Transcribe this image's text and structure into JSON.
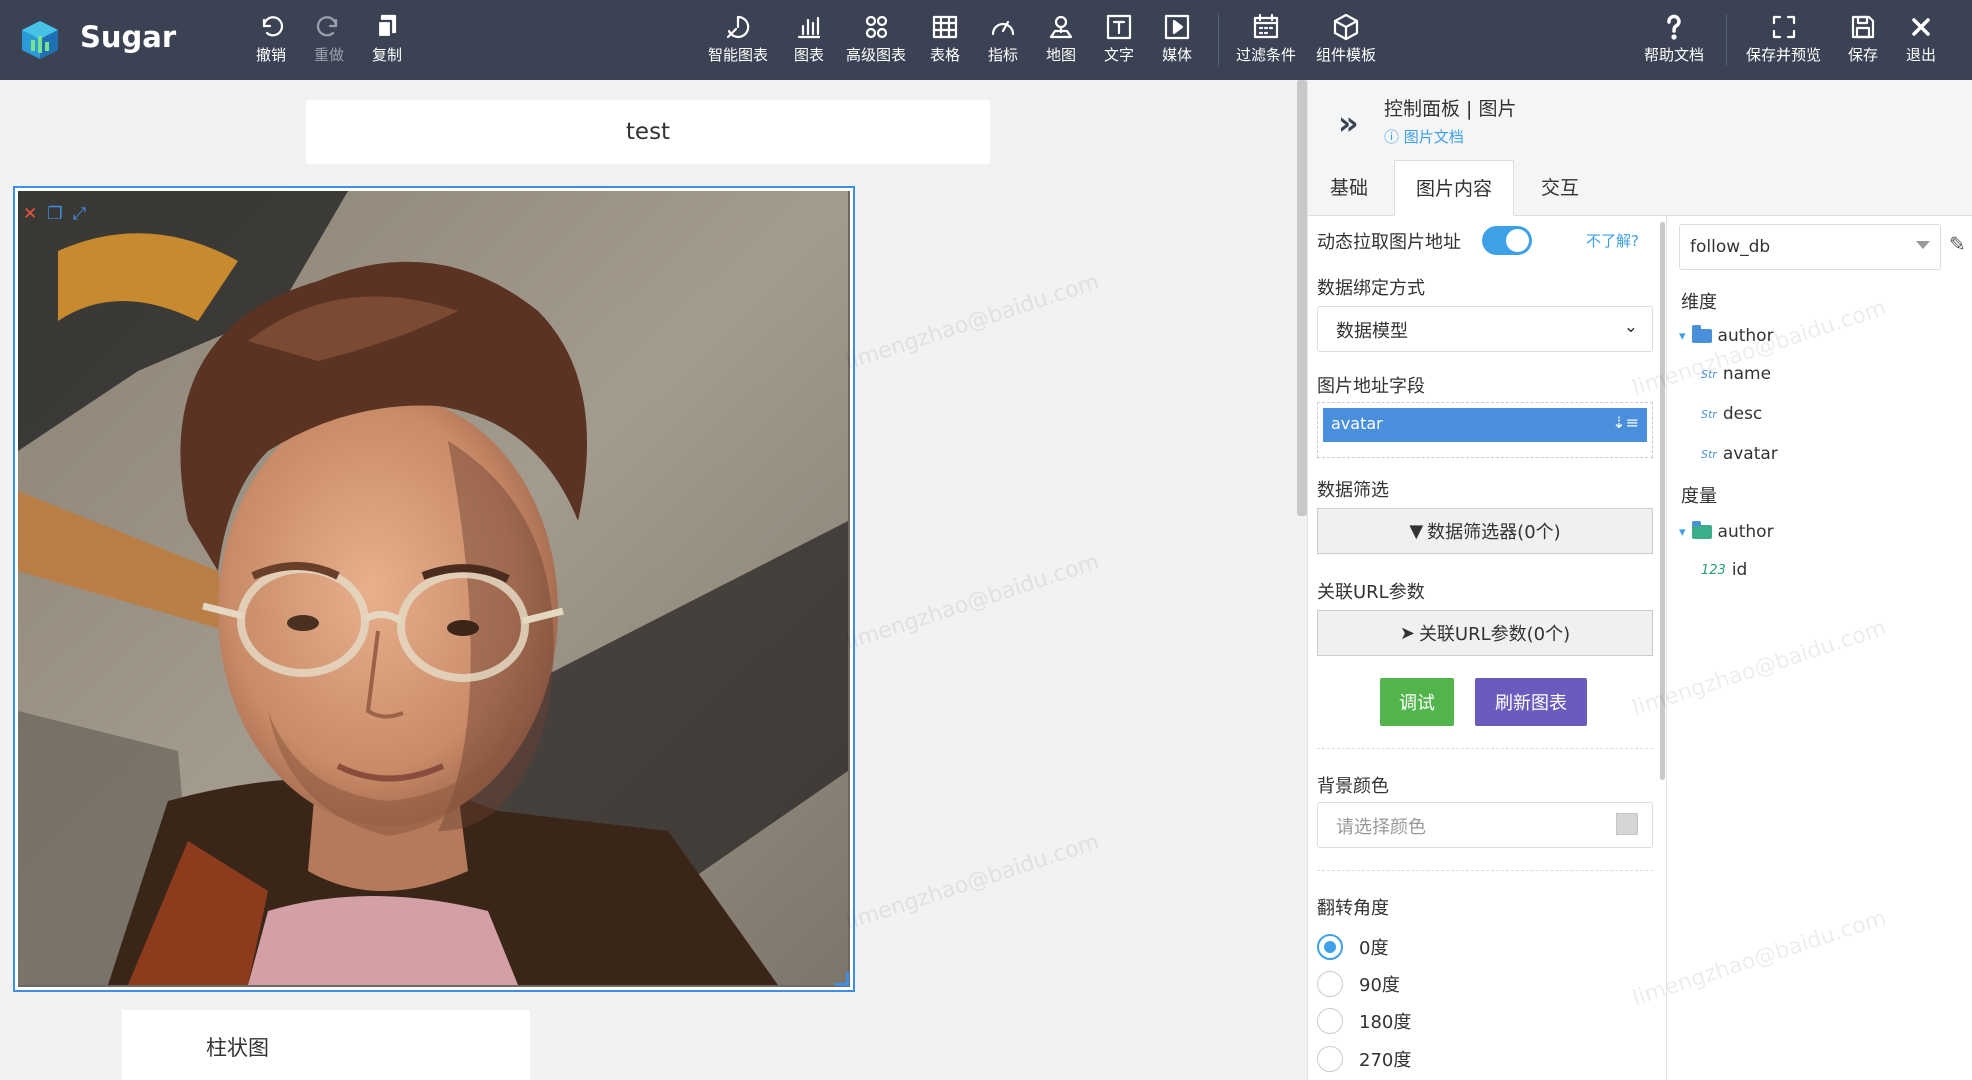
{
  "app": {
    "name": "Sugar"
  },
  "toolbar": {
    "undo": "撤销",
    "redo": "重做",
    "copy": "复制",
    "smart_chart": "智能图表",
    "chart": "图表",
    "advanced_chart": "高级图表",
    "table": "表格",
    "indicator": "指标",
    "map": "地图",
    "text": "文字",
    "media": "媒体",
    "filter": "过滤条件",
    "template": "组件模板",
    "help": "帮助文档",
    "save_preview": "保存并预览",
    "save": "保存",
    "exit": "退出"
  },
  "canvas": {
    "title_widget_text": "test",
    "bar_widget_text": "柱状图"
  },
  "panel": {
    "title": "控制面板 | 图片",
    "doc_link": "图片文档",
    "tabs": [
      "基础",
      "图片内容",
      "交互"
    ],
    "active_tab": "图片内容",
    "dynamic_url_label": "动态拉取图片地址",
    "dynamic_url_on": true,
    "help_link": "不了解?",
    "binding_label": "数据绑定方式",
    "binding_value": "数据模型",
    "url_field_label": "图片地址字段",
    "url_field_value": "avatar",
    "filter_label": "数据筛选",
    "filter_button": "数据筛选器(0个)",
    "url_param_label": "关联URL参数",
    "url_param_button": "关联URL参数(0个)",
    "debug_button": "调试",
    "refresh_button": "刷新图表",
    "bg_color_label": "背景颜色",
    "bg_color_placeholder": "请选择颜色",
    "rotate_label": "翻转角度",
    "rotate_options": [
      "0度",
      "90度",
      "180度",
      "270度"
    ],
    "rotate_selected": "0度"
  },
  "tree": {
    "database": "follow_db",
    "dimension_heading": "维度",
    "measure_heading": "度量",
    "dimension_folder": "author",
    "dimension_fields": [
      {
        "type": "Str",
        "name": "name"
      },
      {
        "type": "Str",
        "name": "desc"
      },
      {
        "type": "Str",
        "name": "avatar"
      }
    ],
    "measure_folder": "author",
    "measure_fields": [
      {
        "type": "123",
        "name": "id"
      }
    ]
  },
  "watermark_text": "limengzhao@baidu.com",
  "colors": {
    "toolbar_bg": "#3b4254",
    "accent_blue": "#3ea0e6",
    "debug_green": "#52b54c",
    "refresh_purple": "#6b5bbd",
    "selection_border": "#3f8fe8"
  }
}
